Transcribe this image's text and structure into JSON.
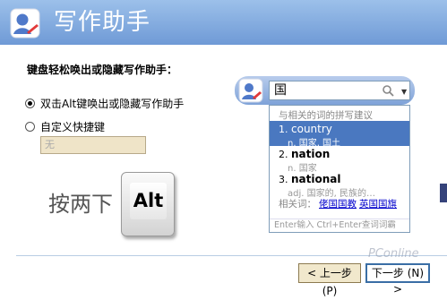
{
  "header": {
    "title": "写作助手"
  },
  "prompt": "键盘轻松唤出或隐藏写作助手：",
  "options": [
    {
      "label": "双击Alt键唤出或隐藏写作助手",
      "selected": true
    },
    {
      "label": "自定义快捷键",
      "selected": false
    }
  ],
  "shortcut_field": {
    "value": "无"
  },
  "hint": {
    "text": "按两下",
    "key": "Alt"
  },
  "buttons": {
    "back": "< 上一步 (P)",
    "next": "下一步 (N) >"
  },
  "ime": {
    "query": "国",
    "header": "与相关的词的拼写建议",
    "candidates": [
      {
        "index": "1.",
        "word": "country",
        "meaning": "n. 国家, 国土",
        "selected": true
      },
      {
        "index": "2.",
        "word": "nation",
        "meaning": "n. 国家",
        "selected": false
      },
      {
        "index": "3.",
        "word": "national",
        "meaning": "adj. 国家的, 民族的…",
        "selected": false
      }
    ],
    "related_label": "相关词：",
    "related": [
      "佬国国教",
      "英国国旗"
    ],
    "footer": "Enter输入 Ctrl+Enter查词词霸"
  },
  "watermark": "PConline",
  "colors": {
    "header": "#7ea2d8",
    "selection": "#4a78c0",
    "button": "#f1e8cc"
  }
}
